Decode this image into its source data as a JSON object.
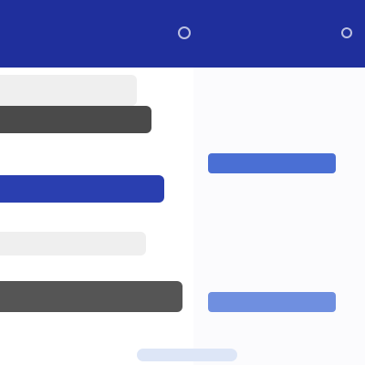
{
  "colors": {
    "app_bar": "#1f2f9c",
    "primary_button": "#4a6fd4",
    "secondary_button": "#6f8fe0",
    "selected_item": "#2a3fb0",
    "dark_item": "#4a4a4a",
    "dark_item_2": "#555555",
    "light_item": "#efefef",
    "panel_bg": "#fbfbfd",
    "hint": "#dde6f7"
  },
  "app_bar": {
    "left_icon": "home-icon",
    "right_icon": "more-icon"
  },
  "stack": {
    "items": [
      {
        "label": "",
        "style": "light"
      },
      {
        "label": "",
        "style": "dark"
      },
      {
        "label": "",
        "style": "selected"
      },
      {
        "label": "",
        "style": "light"
      },
      {
        "label": "",
        "style": "dark"
      }
    ]
  },
  "form": {
    "label_1": "",
    "button_1": "",
    "label_2": "",
    "label_3": "",
    "button_2": ""
  }
}
